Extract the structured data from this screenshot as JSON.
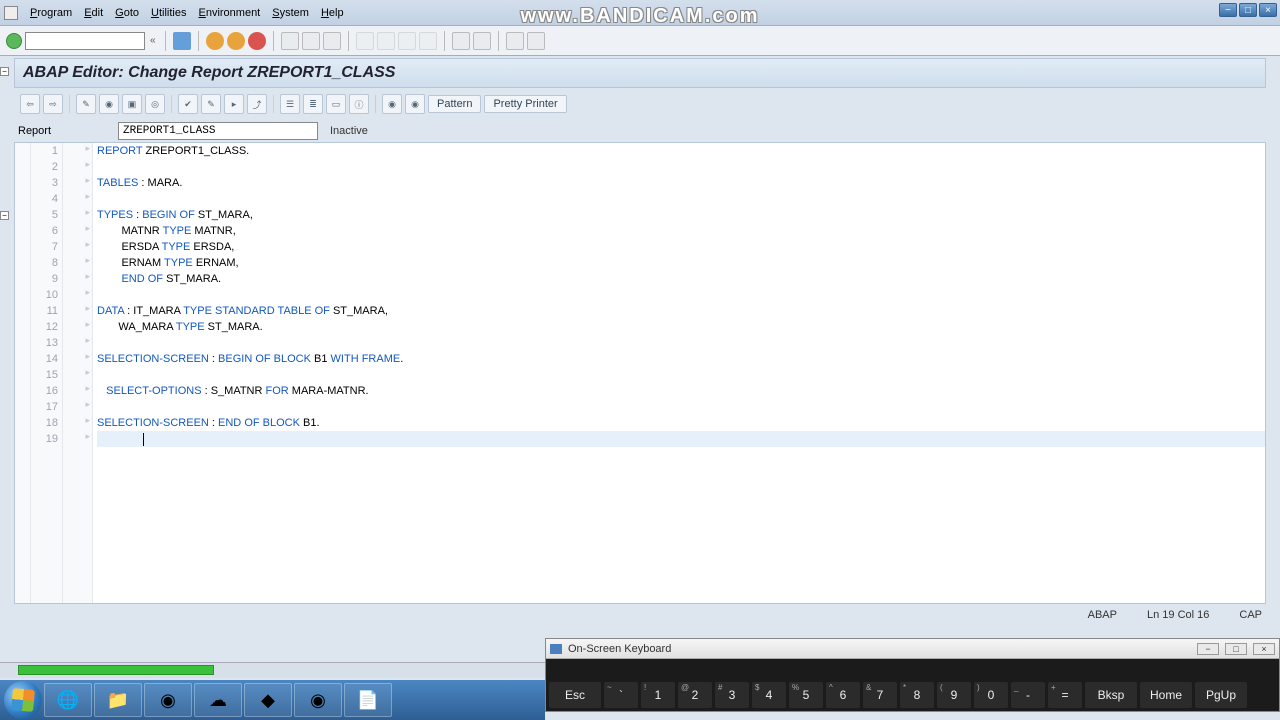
{
  "watermark": "www.BANDICAM.com",
  "menu": [
    "Program",
    "Edit",
    "Goto",
    "Utilities",
    "Environment",
    "System",
    "Help"
  ],
  "app_title": "ABAP Editor: Change Report ZREPORT1_CLASS",
  "app_toolbar_text": {
    "pattern": "Pattern",
    "pretty": "Pretty Printer"
  },
  "report": {
    "label": "Report",
    "name": "ZREPORT1_CLASS",
    "status": "Inactive"
  },
  "code": [
    {
      "n": 1,
      "tokens": [
        [
          "REPORT",
          "kw"
        ],
        [
          " ZREPORT1_CLASS.",
          ""
        ]
      ]
    },
    {
      "n": 2,
      "tokens": []
    },
    {
      "n": 3,
      "tokens": [
        [
          "TABLES",
          "kw"
        ],
        [
          " : MARA.",
          ""
        ]
      ]
    },
    {
      "n": 4,
      "tokens": []
    },
    {
      "n": 5,
      "fold": true,
      "tokens": [
        [
          "TYPES",
          "kw"
        ],
        [
          " : ",
          ""
        ],
        [
          "BEGIN OF",
          "kw"
        ],
        [
          " ST_MARA,",
          ""
        ]
      ]
    },
    {
      "n": 6,
      "tokens": [
        [
          "        MATNR ",
          ""
        ],
        [
          "TYPE",
          "kw"
        ],
        [
          " MATNR,",
          ""
        ]
      ]
    },
    {
      "n": 7,
      "tokens": [
        [
          "        ERSDA ",
          ""
        ],
        [
          "TYPE",
          "kw"
        ],
        [
          " ERSDA,",
          ""
        ]
      ]
    },
    {
      "n": 8,
      "tokens": [
        [
          "        ERNAM ",
          ""
        ],
        [
          "TYPE",
          "kw"
        ],
        [
          " ERNAM,",
          ""
        ]
      ]
    },
    {
      "n": 9,
      "tokens": [
        [
          "        ",
          ""
        ],
        [
          "END OF",
          "kw"
        ],
        [
          " ST_MARA.",
          ""
        ]
      ]
    },
    {
      "n": 10,
      "tokens": []
    },
    {
      "n": 11,
      "tokens": [
        [
          "DATA",
          "kw"
        ],
        [
          " : IT_MARA ",
          ""
        ],
        [
          "TYPE STANDARD TABLE OF",
          "kw"
        ],
        [
          " ST_MARA,",
          ""
        ]
      ]
    },
    {
      "n": 12,
      "tokens": [
        [
          "       WA_MARA ",
          ""
        ],
        [
          "TYPE",
          "kw"
        ],
        [
          " ST_MARA.",
          ""
        ]
      ]
    },
    {
      "n": 13,
      "tokens": []
    },
    {
      "n": 14,
      "fold": true,
      "tokens": [
        [
          "SELECTION-SCREEN",
          "kw"
        ],
        [
          " : ",
          ""
        ],
        [
          "BEGIN",
          "kw"
        ],
        [
          " ",
          ""
        ],
        [
          "OF",
          "kw"
        ],
        [
          " ",
          ""
        ],
        [
          "BLOCK",
          "kw"
        ],
        [
          " B1 ",
          ""
        ],
        [
          "WITH FRAME",
          "kw"
        ],
        [
          ".",
          ""
        ]
      ]
    },
    {
      "n": 15,
      "tokens": []
    },
    {
      "n": 16,
      "tokens": [
        [
          "   ",
          ""
        ],
        [
          "SELECT-OPTIONS",
          "kw"
        ],
        [
          " : S_MATNR ",
          ""
        ],
        [
          "FOR",
          "kw"
        ],
        [
          " MARA-MATNR.",
          ""
        ]
      ]
    },
    {
      "n": 17,
      "tokens": []
    },
    {
      "n": 18,
      "tokens": [
        [
          "SELECTION-SCREEN",
          "kw"
        ],
        [
          " : ",
          ""
        ],
        [
          "END",
          "kw"
        ],
        [
          " ",
          ""
        ],
        [
          "OF",
          "kw"
        ],
        [
          " ",
          ""
        ],
        [
          "BLOCK",
          "kw"
        ],
        [
          " B1.",
          ""
        ]
      ]
    },
    {
      "n": 19,
      "current": true,
      "caret_col": 16,
      "tokens": []
    }
  ],
  "statusbar": {
    "lang": "ABAP",
    "pos": "Ln  19 Col  16",
    "cap": "CAP"
  },
  "osk": {
    "title": "On-Screen Keyboard",
    "row1": [
      {
        "l": "Esc",
        "w": true
      },
      {
        "s": "~",
        "l": "`"
      },
      {
        "s": "!",
        "l": "1"
      },
      {
        "s": "@",
        "l": "2"
      },
      {
        "s": "#",
        "l": "3"
      },
      {
        "s": "$",
        "l": "4"
      },
      {
        "s": "%",
        "l": "5"
      },
      {
        "s": "^",
        "l": "6"
      },
      {
        "s": "&",
        "l": "7"
      },
      {
        "s": "*",
        "l": "8"
      },
      {
        "s": "(",
        "l": "9"
      },
      {
        "s": ")",
        "l": "0"
      },
      {
        "s": "_",
        "l": "-"
      },
      {
        "s": "+",
        "l": "="
      },
      {
        "l": "Bksp",
        "w": true
      },
      {
        "l": "Home",
        "w": true
      },
      {
        "l": "PgUp",
        "w": true
      }
    ]
  },
  "taskbar_icons": [
    "ie",
    "explorer",
    "chrome",
    "skype",
    "shortcut",
    "bandicam",
    "wordpad"
  ]
}
